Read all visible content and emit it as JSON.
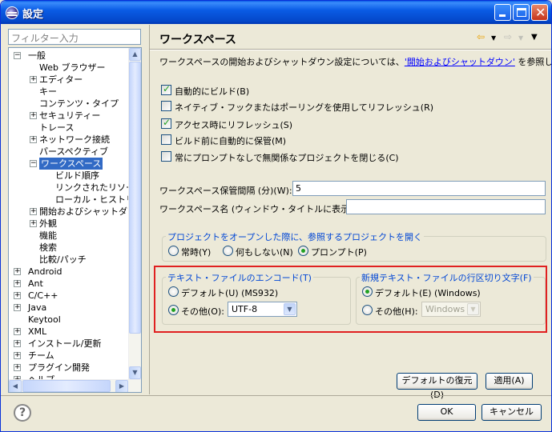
{
  "window": {
    "title": "設定"
  },
  "filter": {
    "placeholder": "フィルター入力"
  },
  "tree": [
    {
      "label": "一般",
      "level": 0,
      "expander": "−"
    },
    {
      "label": "Web ブラウザー",
      "level": 1,
      "expander": ""
    },
    {
      "label": "エディター",
      "level": 1,
      "expander": "+"
    },
    {
      "label": "キー",
      "level": 1,
      "expander": ""
    },
    {
      "label": "コンテンツ・タイプ",
      "level": 1,
      "expander": ""
    },
    {
      "label": "セキュリティー",
      "level": 1,
      "expander": "+"
    },
    {
      "label": "トレース",
      "level": 1,
      "expander": ""
    },
    {
      "label": "ネットワーク接続",
      "level": 1,
      "expander": "+"
    },
    {
      "label": "パースペクティブ",
      "level": 1,
      "expander": ""
    },
    {
      "label": "ワークスペース",
      "level": 1,
      "expander": "−",
      "selected": true
    },
    {
      "label": "ビルド順序",
      "level": 2,
      "expander": ""
    },
    {
      "label": "リンクされたリソース",
      "level": 2,
      "expander": ""
    },
    {
      "label": "ローカル・ヒストリー",
      "level": 2,
      "expander": ""
    },
    {
      "label": "開始およびシャットダウン",
      "level": 1,
      "expander": "+"
    },
    {
      "label": "外観",
      "level": 1,
      "expander": "+"
    },
    {
      "label": "機能",
      "level": 1,
      "expander": ""
    },
    {
      "label": "検索",
      "level": 1,
      "expander": ""
    },
    {
      "label": "比較/パッチ",
      "level": 1,
      "expander": ""
    },
    {
      "label": "Android",
      "level": 0,
      "expander": "+"
    },
    {
      "label": "Ant",
      "level": 0,
      "expander": "+"
    },
    {
      "label": "C/C++",
      "level": 0,
      "expander": "+"
    },
    {
      "label": "Java",
      "level": 0,
      "expander": "+"
    },
    {
      "label": "Keytool",
      "level": 0,
      "expander": ""
    },
    {
      "label": "XML",
      "level": 0,
      "expander": "+"
    },
    {
      "label": "インストール/更新",
      "level": 0,
      "expander": "+"
    },
    {
      "label": "チーム",
      "level": 0,
      "expander": "+"
    },
    {
      "label": "プラグイン開発",
      "level": 0,
      "expander": "+"
    },
    {
      "label": "ヘルプ",
      "level": 0,
      "expander": "+"
    }
  ],
  "page": {
    "title": "ワークスペース",
    "desc_prefix": "ワークスペースの開始およびシャットダウン設定については、",
    "desc_link": "'開始およびシャットダウン'",
    "desc_suffix": " を参照してください。",
    "checkboxes": [
      {
        "label": "自動的にビルド(B)",
        "checked": true
      },
      {
        "label": "ネイティブ・フックまたはポーリングを使用してリフレッシュ(R)",
        "checked": false
      },
      {
        "label": "アクセス時にリフレッシュ(S)",
        "checked": true
      },
      {
        "label": "ビルド前に自動的に保管(M)",
        "checked": false
      },
      {
        "label": "常にプロンプトなしで無関係なプロジェクトを閉じる(C)",
        "checked": false
      }
    ],
    "save_interval_label": "ワークスペース保管間隔 (分)(W):",
    "save_interval_value": "5",
    "ws_name_label": "ワークスペース名 (ウィンドウ・タイトルに表示)(K):",
    "ws_name_value": "",
    "open_ref": {
      "title": "プロジェクトをオープンした際に、参照するプロジェクトを開く",
      "options": [
        {
          "label": "常時(Y)",
          "selected": false
        },
        {
          "label": "何もしない(N)",
          "selected": false
        },
        {
          "label": "プロンプト(P)",
          "selected": true
        }
      ]
    },
    "encoding": {
      "title": "テキスト・ファイルのエンコード(T)",
      "default_label": "デフォルト(U) (MS932)",
      "default_selected": false,
      "other_label": "その他(O):",
      "other_selected": true,
      "other_value": "UTF-8"
    },
    "line_delim": {
      "title": "新規テキスト・ファイルの行区切り文字(F)",
      "default_label": "デフォルト(E) (Windows)",
      "default_selected": true,
      "other_label": "その他(H):",
      "other_selected": false,
      "other_value": "Windows"
    },
    "restore_defaults": "デフォルトの復元(D)",
    "apply": "適用(A)"
  },
  "footer": {
    "ok": "OK",
    "cancel": "キャンセル",
    "help": "?"
  },
  "colors": {
    "highlight": "#e02020",
    "selection": "#316ac5",
    "link": "#0000ff",
    "group_title": "#0046d5"
  }
}
